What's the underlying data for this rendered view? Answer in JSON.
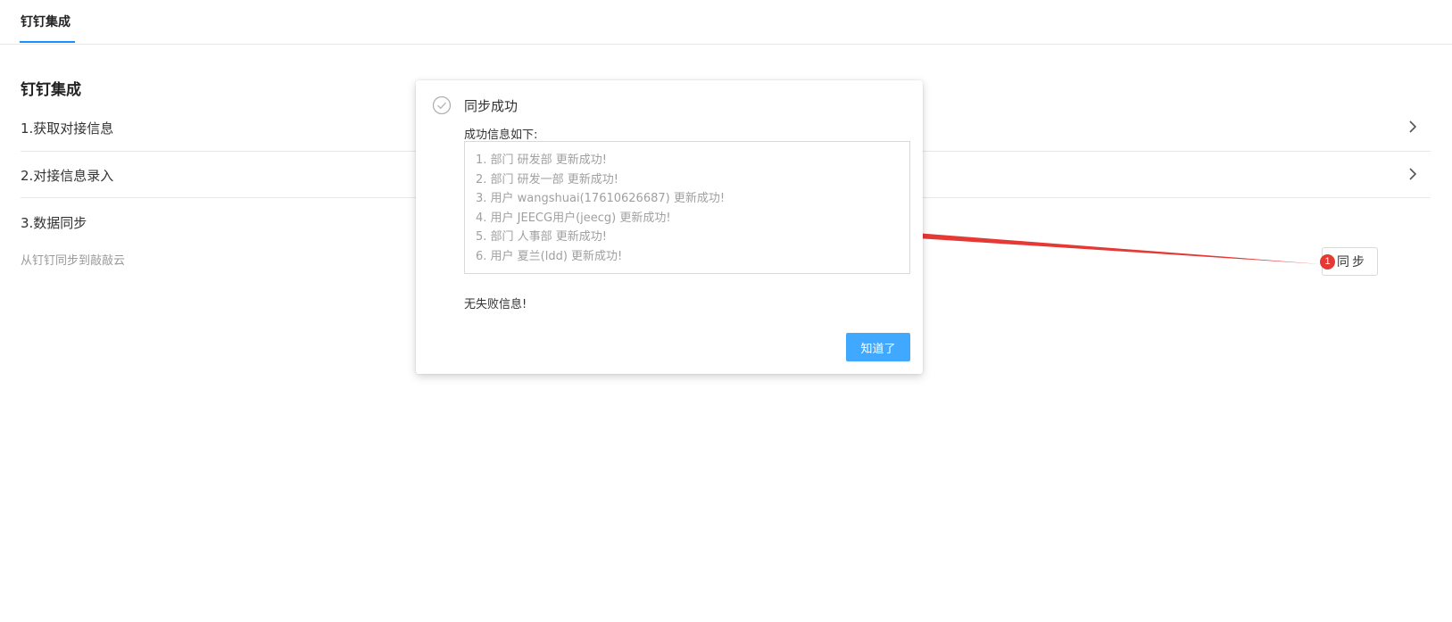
{
  "tabs": [
    {
      "label": "钉钉集成",
      "active": true
    }
  ],
  "section": {
    "title": "钉钉集成",
    "items": [
      {
        "label": "1.获取对接信息"
      },
      {
        "label": "2.对接信息录入"
      },
      {
        "label": "3.数据同步"
      }
    ],
    "sync_description": "从钉钉同步到敲敲云",
    "sync_button": "同步",
    "annotation_badge": "1"
  },
  "modal": {
    "icon": "check-circle-icon",
    "title": "同步成功",
    "subtitle": "成功信息如下:",
    "results": [
      "1. 部门 研发部 更新成功!",
      "2. 部门 研发一部 更新成功!",
      "3. 用户 wangshuai(17610626687) 更新成功!",
      "4. 用户 JEECG用户(jeecg) 更新成功!",
      "5. 部门 人事部 更新成功!",
      "6. 用户 夏兰(ldd) 更新成功!"
    ],
    "failure_text": "无失败信息!",
    "ok_button": "知道了"
  },
  "colors": {
    "accent": "#1890ff",
    "primary_button": "#40a9ff",
    "annotation_red": "#e53935"
  }
}
